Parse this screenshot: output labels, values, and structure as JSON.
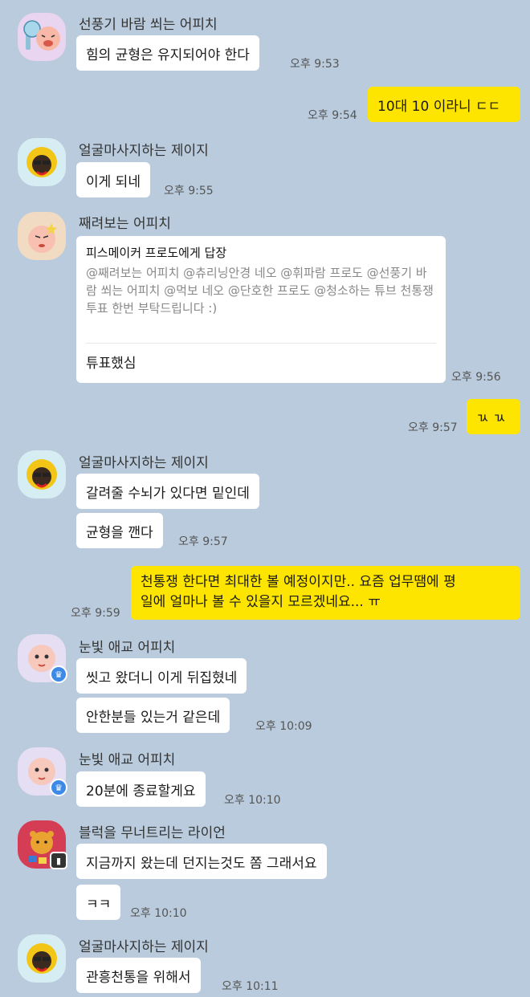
{
  "messages": [
    {
      "sender": "선풍기 바람 쐬는 어피치",
      "text": "힘의 균형은 유지되어야 한다",
      "time": "오후 9:53"
    },
    {
      "text": "10대 10 이라니 ㄷㄷ",
      "time": "오후 9:54"
    },
    {
      "sender": "얼굴마사지하는 제이지",
      "text": "이게 되네",
      "time": "오후 9:55"
    },
    {
      "sender": "째려보는 어피치",
      "reply_title": "피스메이커 프로도에게 답장",
      "reply_quote": "@째려보는 어피치 @츄리닝안경 네오 @휘파람 프로도 @선풍기 바람 쐬는 어피치 @먹보 네오 @단호한 프로도 @청소하는 튜브 천통쟁 투표 한번 부탁드립니다 :)",
      "text": "튜표했심",
      "time": "오후 9:56"
    },
    {
      "text": "ㄳ ㄳ",
      "time": "오후 9:57"
    },
    {
      "sender": "얼굴마사지하는 제이지",
      "text": "갈려줄 수뇌가 있다면 밑인데",
      "text2": "균형을 깬다",
      "time": "오후 9:57"
    },
    {
      "text_line1": "천통쟁 한다면 최대한 볼 예정이지만.. 요즘 업무땜에 평",
      "text_line2": "일에 얼마나 볼 수 있을지 모르겠네요... ㅠ",
      "time": "오후 9:59"
    },
    {
      "sender": "눈빛 애교 어피치",
      "text": "씻고 왔더니 이게 뒤집혔네",
      "text2": "안한분들 있는거 같은데",
      "time": "오후 10:09"
    },
    {
      "sender": "눈빛 애교 어피치",
      "text": "20분에 종료할게요",
      "time": "오후 10:10"
    },
    {
      "sender": "블럭을 무너트리는 라이언",
      "text": "지금까지 왔는데 던지는것도 쫌 그래서요",
      "text2": "ㅋㅋ",
      "time": "오후 10:10"
    },
    {
      "sender": "얼굴마사지하는 제이지",
      "text": "관흥천통을 위해서",
      "time": "오후 10:11"
    }
  ],
  "colors": {
    "background": "#b9cbdc",
    "my_bubble": "#fee500",
    "other_bubble": "#ffffff"
  },
  "avatars": [
    "apeach-fan-icon",
    "jayg-face-icon",
    "apeach-glare-icon",
    "apeach-wink-icon",
    "ryan-blocks-icon"
  ]
}
